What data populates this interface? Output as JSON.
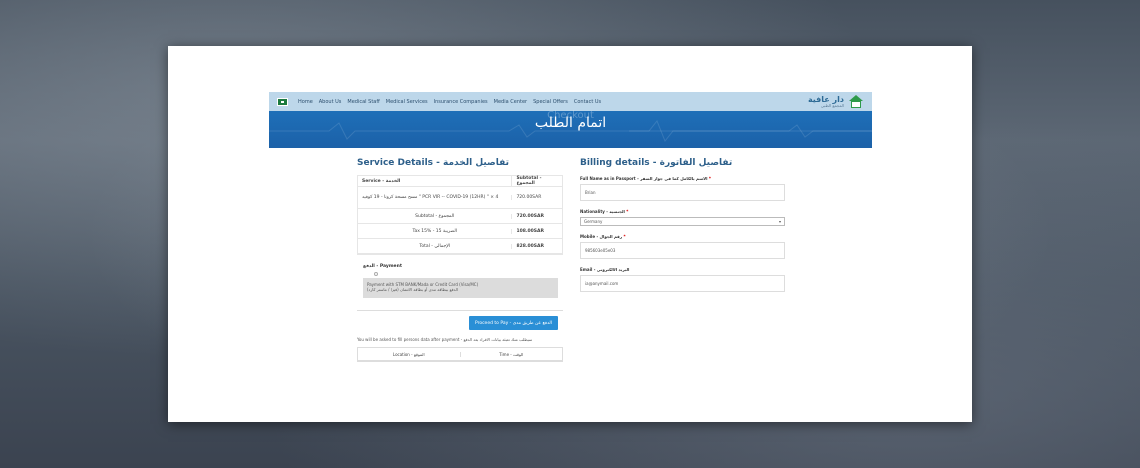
{
  "nav": {
    "links": [
      "Home",
      "About Us",
      "Medical Staff",
      "Medical Services",
      "Insurance Companies",
      "Media Center",
      "Special Offers",
      "Contact Us"
    ],
    "logo_title": "دار عافية",
    "logo_subtitle": "المجمع الطبي"
  },
  "hero": {
    "title": "اتمام الطلب",
    "ghost_title": "Checkout"
  },
  "billing": {
    "title": "Billing details - تفاصيل الفاتورة",
    "fields": [
      {
        "label": "Full Name as in Passport - الاسم بالكامل كما في جواز السفر",
        "value": "Brian"
      },
      {
        "label": "Nationality - الجنسية",
        "value": "Germany"
      },
      {
        "label": "Mobile - رقم الجوال",
        "value": "985603e05e03"
      },
      {
        "label": "Email - البريد الالكتروني",
        "value": "ia@anymail.com"
      }
    ]
  },
  "service": {
    "title": "Service Details - تفاصيل الخدمة",
    "col_service": "Service - الخدمة",
    "col_subtotal": "Subtotal - المجموع",
    "item_name": "مسح مسحة كرونا - 19 كوفيد \" PCR VIR -- COVID-19 (12HR) \" × 4",
    "item_amount": "720.00SAR",
    "summary": [
      {
        "label": "Subtotal - المجموع",
        "value": "720.00SAR"
      },
      {
        "label": "Tax 15% - الضريبة 15",
        "value": "108.00SAR"
      },
      {
        "label": "Total - الإجمالي",
        "value": "828.00SAR"
      }
    ]
  },
  "payment": {
    "title": "الدفع - Payment",
    "method_line1": "Payment with STM BANK/Mada or Credit Card (Visa/MC)",
    "method_line2": "الدفع ببطاقة مدى أو بطاقة الائتمان (فيزا / ماستر كارد)",
    "button": "Proceed to Pay - الدفع عن طريق مدى",
    "note": "You will be asked to fill persons data after payment - سيطلب منك تعبئة بيانات الافراد بعد الدفع",
    "table_headers": [
      "Location - الموقع",
      "Time - الوقت"
    ]
  }
}
